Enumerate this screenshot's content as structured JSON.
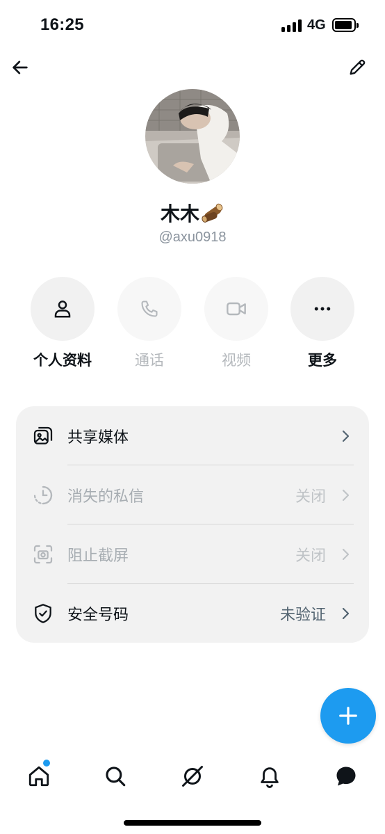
{
  "status_bar": {
    "time": "16:25",
    "network": "4G"
  },
  "profile": {
    "display_name": "木木",
    "handle": "@axu0918"
  },
  "actions": [
    {
      "label": "个人资料",
      "icon": "person-icon",
      "enabled": true
    },
    {
      "label": "通话",
      "icon": "phone-icon",
      "enabled": false
    },
    {
      "label": "视频",
      "icon": "video-camera-icon",
      "enabled": false
    },
    {
      "label": "更多",
      "icon": "more-dots-icon",
      "enabled": true
    }
  ],
  "settings": [
    {
      "label": "共享媒体",
      "icon": "media-gallery-icon",
      "value": "",
      "enabled": true
    },
    {
      "label": "消失的私信",
      "icon": "timer-icon",
      "value": "关闭",
      "enabled": false
    },
    {
      "label": "阻止截屏",
      "icon": "screenshot-block-icon",
      "value": "关闭",
      "enabled": false
    },
    {
      "label": "安全号码",
      "icon": "shield-check-icon",
      "value": "未验证",
      "enabled": true
    }
  ],
  "tabbar": [
    "home-icon",
    "search-icon",
    "grok-icon",
    "notifications-bell-icon",
    "messages-icon"
  ],
  "colors": {
    "accent": "#1d9bf0",
    "card_bg": "#f2f2f2",
    "text": "#0f1419",
    "muted": "#536471"
  }
}
